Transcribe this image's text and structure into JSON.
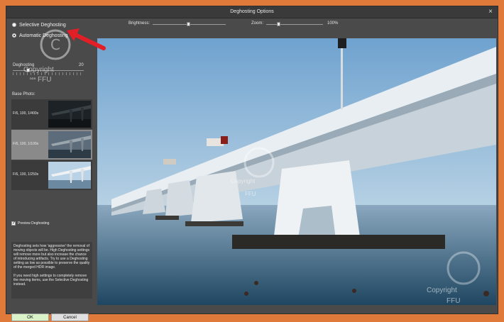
{
  "window": {
    "title": "Deghosting Options",
    "close": "×"
  },
  "mode": {
    "selective_label": "Selective Deghosting",
    "automatic_label": "Automatic Deghosting",
    "selected": "automatic"
  },
  "deghosting": {
    "label": "Deghosting",
    "value": "20",
    "marker": "DDS"
  },
  "base_photo": {
    "label": "Base Photo:",
    "items": [
      {
        "label": "F/6, 100, 1/400s"
      },
      {
        "label": "F/6, 100, 1/100s",
        "selected": true
      },
      {
        "label": "F/6, 100, 1/250s"
      }
    ]
  },
  "preview": {
    "label": "Preview Deghosting",
    "checked": true
  },
  "info": {
    "para1": "Deghosting sets how 'aggressive' the removal of moving objects will be. High Deghosting settings will remove more but also increase the chance of introducing artifacts. Try to use a Deghosting setting as low as possible to preserve the quality of the merged HDR image.",
    "para2": "If you need high settings to completely remove the moving items, use the Selective Deghosting instead."
  },
  "buttons": {
    "ok": "OK",
    "cancel": "Cancel"
  },
  "top_controls": {
    "brightness_label": "Brightness:",
    "zoom_label": "Zoom:",
    "zoom_value": "100%"
  },
  "watermarks": [
    {
      "line1": "Copyright",
      "line2": "FFU"
    },
    {
      "line1": "Copyright",
      "line2": "FFU"
    },
    {
      "line1": "Copyright",
      "line2": "FFU"
    }
  ],
  "colors": {
    "ok_button": "#d9f2c7",
    "annotation_arrow": "#e21f26",
    "frame": "#e07a3a"
  }
}
